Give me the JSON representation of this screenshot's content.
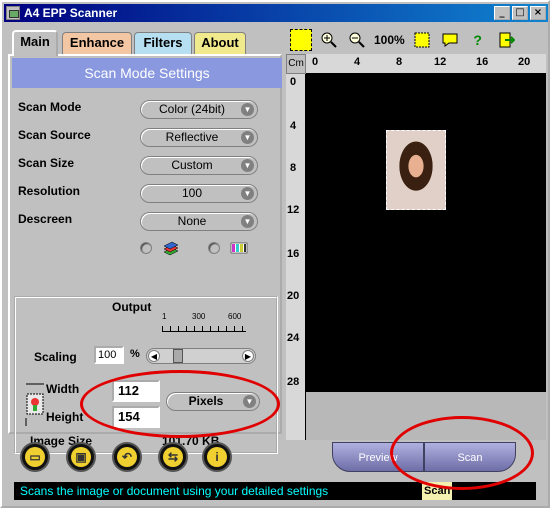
{
  "window": {
    "title": "A4 EPP Scanner",
    "buttons": [
      "_",
      "□",
      "×"
    ]
  },
  "tabs": [
    {
      "label": "Main"
    },
    {
      "label": "Enhance"
    },
    {
      "label": "Filters"
    },
    {
      "label": "About"
    }
  ],
  "panel_header": "Scan Mode Settings",
  "settings": [
    {
      "label": "Scan Mode",
      "value": "Color (24bit)"
    },
    {
      "label": "Scan Source",
      "value": "Reflective"
    },
    {
      "label": "Scan Size",
      "value": "Custom"
    },
    {
      "label": "Resolution",
      "value": "100"
    },
    {
      "label": "Descreen",
      "value": "None"
    }
  ],
  "output": {
    "title": "Output",
    "scaling_label": "Scaling",
    "scaling_value": "100",
    "scaling_unit": "%",
    "scale_ticks": [
      "1",
      "300",
      "600"
    ],
    "slider_value": 100,
    "width_label": "Width",
    "width_value": "112",
    "height_label": "Height",
    "height_value": "154",
    "unit": "Pixels",
    "image_size_label": "Image Size",
    "image_size_value": "101.70 KB"
  },
  "toolbar": {
    "zoom_label": "100%"
  },
  "ruler": {
    "unit": "Cm",
    "top": [
      "0",
      "4",
      "8",
      "12",
      "16",
      "20"
    ],
    "left": [
      "0",
      "4",
      "8",
      "12",
      "16",
      "20",
      "24",
      "28"
    ]
  },
  "actions": {
    "preview": "Preview",
    "scan": "Scan"
  },
  "status": {
    "text": "Scans the image or document using your detailed settings",
    "tag": "Scan"
  },
  "colors": {
    "title_bar": "#000080",
    "panel_header": "#8a98e0",
    "annotation": "#e00000",
    "status_text": "#00ffff"
  }
}
